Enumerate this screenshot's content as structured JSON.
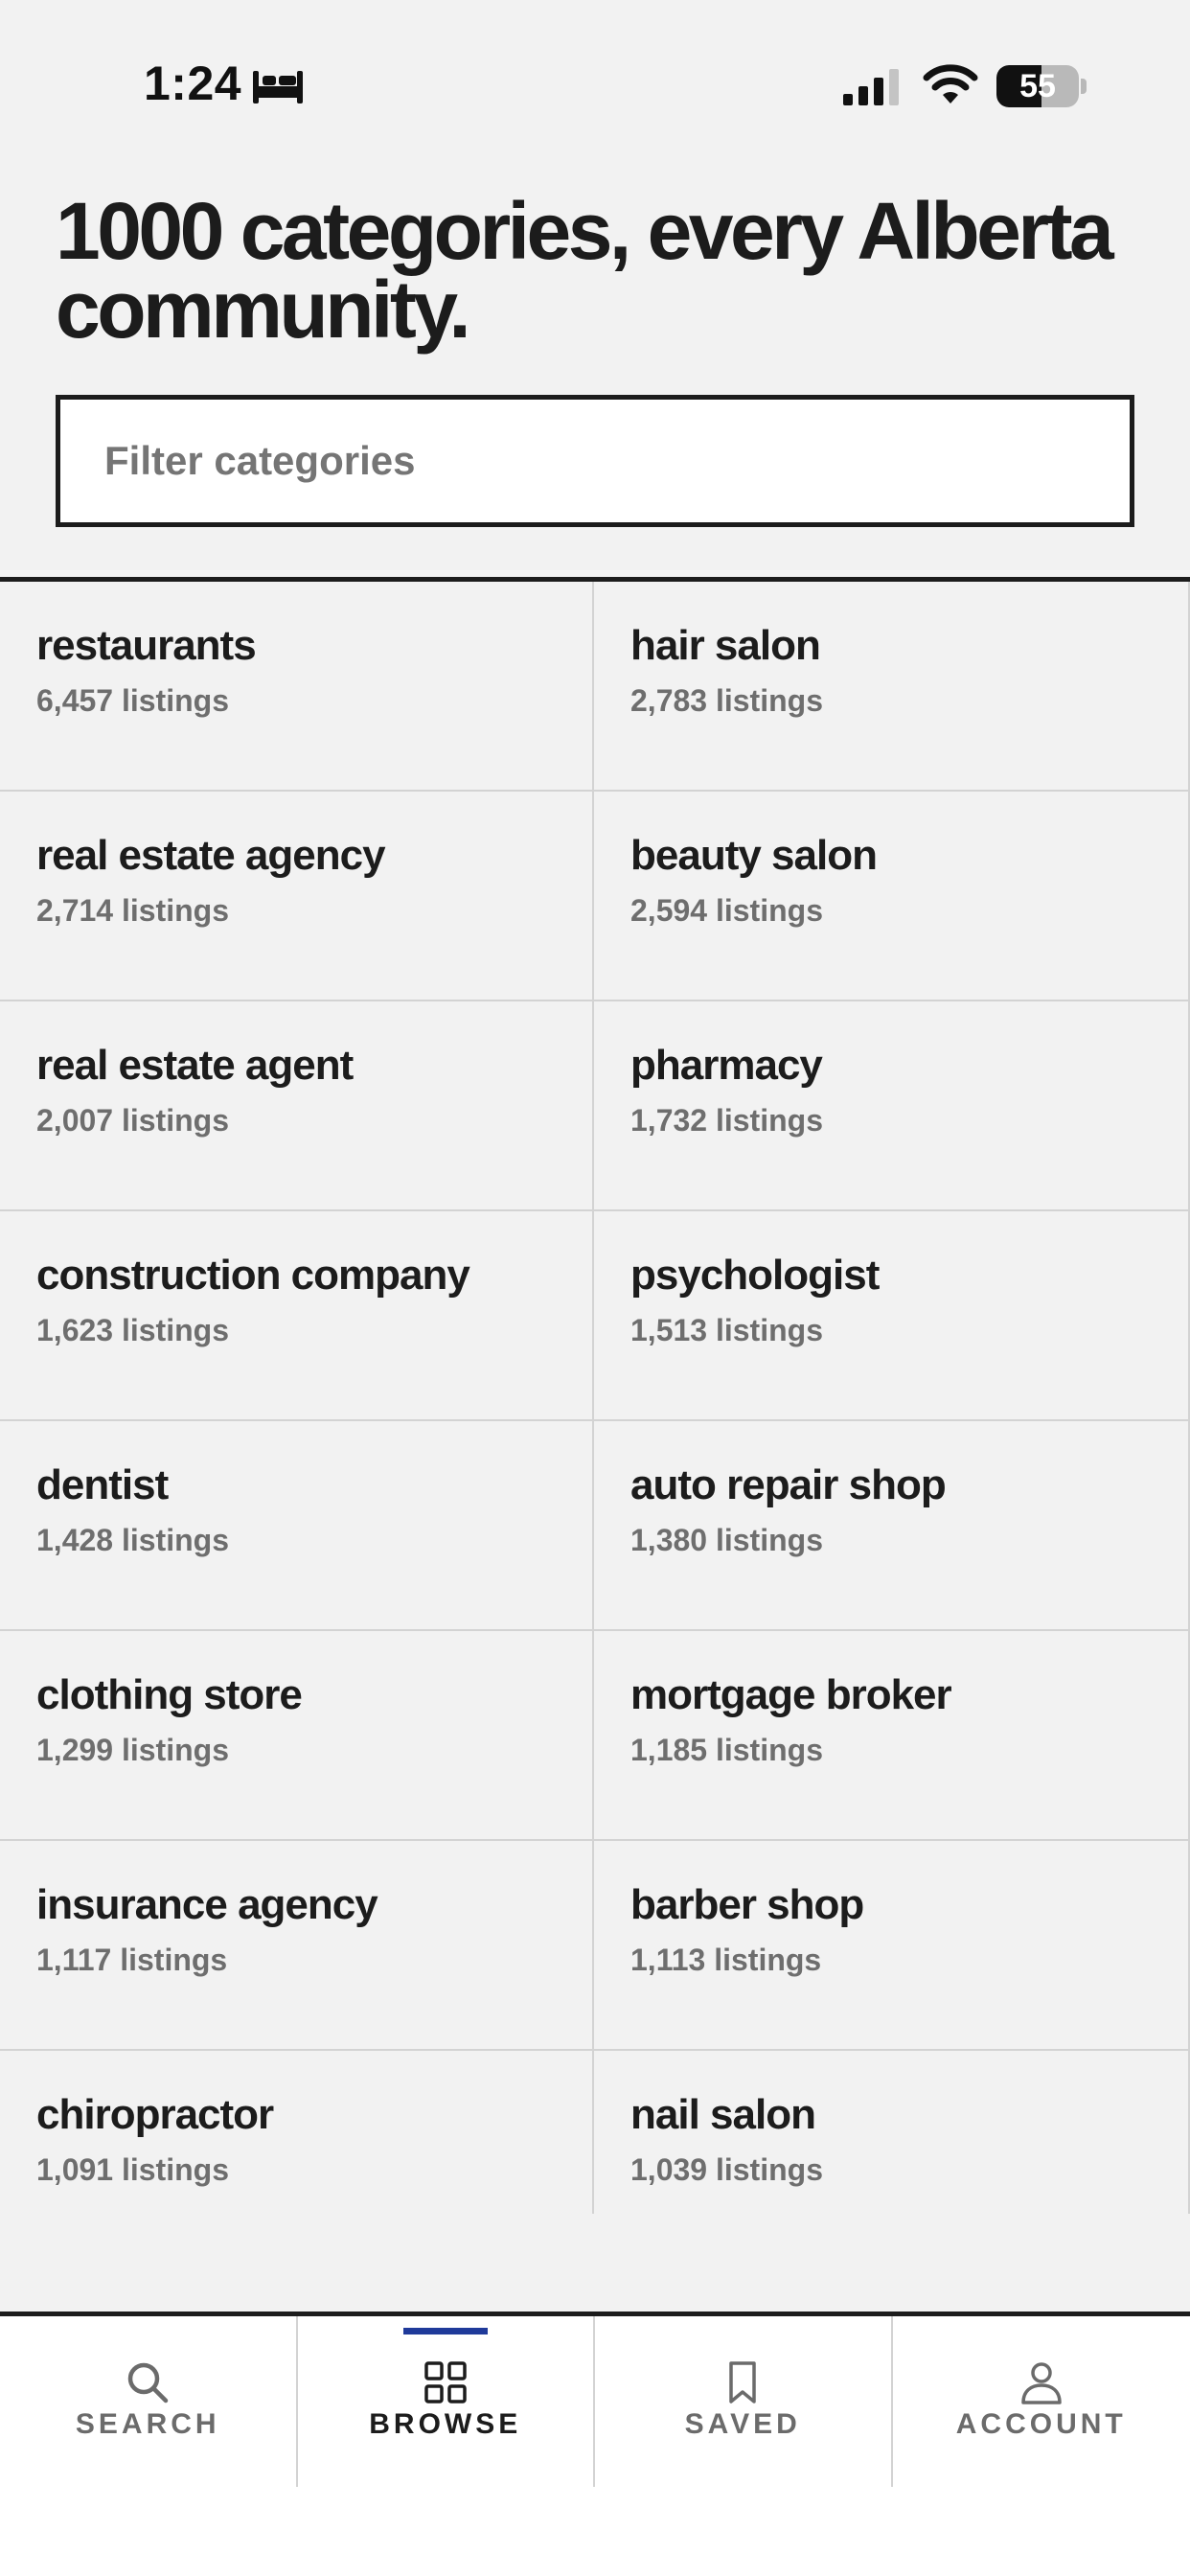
{
  "status_bar": {
    "time": "1:24",
    "battery": "55",
    "battery_level": 0.55
  },
  "header": {
    "headline": "1000 categories, every Alberta community."
  },
  "filter": {
    "placeholder": "Filter categories"
  },
  "categories": [
    {
      "name": "restaurants",
      "count": "6,457 listings"
    },
    {
      "name": "hair salon",
      "count": "2,783 listings"
    },
    {
      "name": "real estate agency",
      "count": "2,714 listings"
    },
    {
      "name": "beauty salon",
      "count": "2,594 listings"
    },
    {
      "name": "real estate agent",
      "count": "2,007 listings"
    },
    {
      "name": "pharmacy",
      "count": "1,732 listings"
    },
    {
      "name": "construction company",
      "count": "1,623 listings"
    },
    {
      "name": "psychologist",
      "count": "1,513 listings"
    },
    {
      "name": "dentist",
      "count": "1,428 listings"
    },
    {
      "name": "auto repair shop",
      "count": "1,380 listings"
    },
    {
      "name": "clothing store",
      "count": "1,299 listings"
    },
    {
      "name": "mortgage broker",
      "count": "1,185 listings"
    },
    {
      "name": "insurance agency",
      "count": "1,117 listings"
    },
    {
      "name": "barber shop",
      "count": "1,113 listings"
    },
    {
      "name": "chiropractor",
      "count": "1,091 listings"
    },
    {
      "name": "nail salon",
      "count": "1,039 listings"
    }
  ],
  "nav": {
    "items": [
      {
        "label": "SEARCH",
        "icon": "search-icon",
        "active": false
      },
      {
        "label": "BROWSE",
        "icon": "grid-icon",
        "active": true
      },
      {
        "label": "SAVED",
        "icon": "bookmark-icon",
        "active": false
      },
      {
        "label": "ACCOUNT",
        "icon": "person-icon",
        "active": false
      }
    ]
  },
  "colors": {
    "background": "#f2f2f2",
    "text": "#1c1c1c",
    "muted": "#6e6e6e",
    "accent": "#1f3a9a"
  }
}
